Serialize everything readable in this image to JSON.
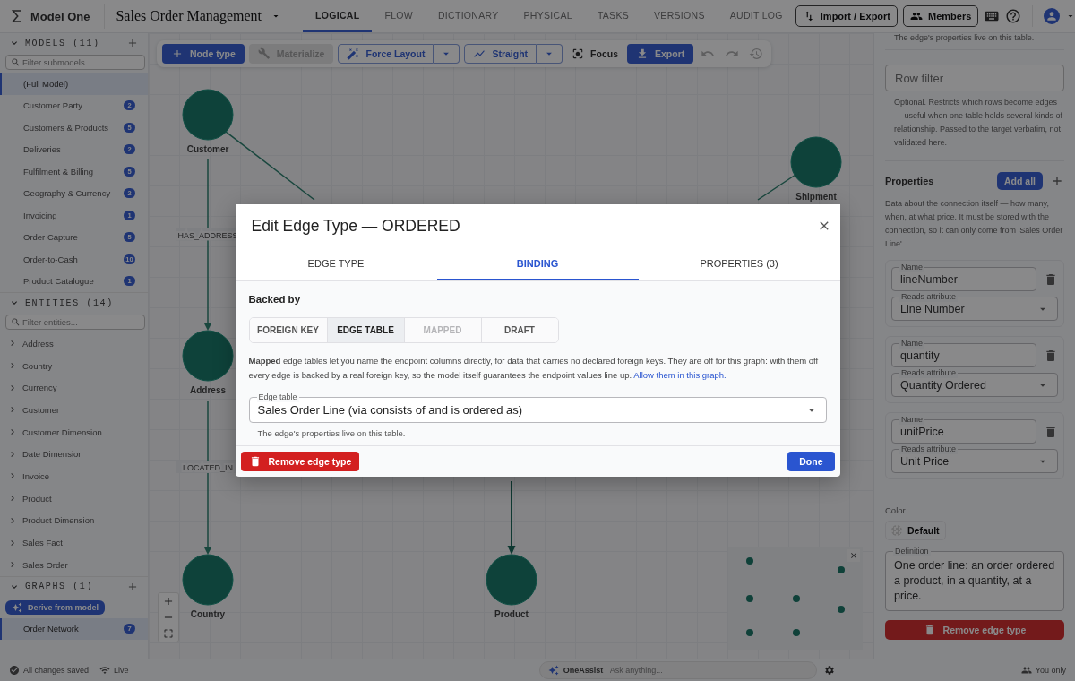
{
  "app": {
    "name": "Model One",
    "project": "Sales Order Management"
  },
  "nav_tabs": [
    {
      "label": "LOGICAL",
      "selected": true
    },
    {
      "label": "FLOW",
      "selected": false
    },
    {
      "label": "DICTIONARY",
      "selected": false
    },
    {
      "label": "PHYSICAL",
      "selected": false
    },
    {
      "label": "TASKS",
      "selected": false
    },
    {
      "label": "VERSIONS",
      "selected": false
    },
    {
      "label": "AUDIT LOG",
      "selected": false
    }
  ],
  "header_buttons": [
    "Import / Export",
    "Members"
  ],
  "sidebar": {
    "models": {
      "title": "MODELS (11)",
      "placeholder": "Filter submodels...",
      "items": [
        {
          "name": "(Full Model)",
          "selected": true
        },
        {
          "name": "Customer Party",
          "count": "2",
          "selected": false
        },
        {
          "name": "Customers & Products",
          "count": "5",
          "selected": false
        },
        {
          "name": "Deliveries",
          "count": "2",
          "selected": false
        },
        {
          "name": "Fulfilment & Billing",
          "count": "5",
          "selected": false
        },
        {
          "name": "Geography & Currency",
          "count": "2",
          "selected": false
        },
        {
          "name": "Invoicing",
          "count": "1",
          "selected": false
        },
        {
          "name": "Order Capture",
          "count": "5",
          "selected": false
        },
        {
          "name": "Order-to-Cash",
          "count": "10",
          "selected": false
        },
        {
          "name": "Product Catalogue",
          "count": "1",
          "selected": false
        }
      ]
    },
    "entities": {
      "title": "ENTITIES (14)",
      "placeholder": "Filter entities...",
      "items": [
        {
          "name": "Address",
          "expanded": false
        },
        {
          "name": "Country",
          "expanded": false
        },
        {
          "name": "Currency",
          "expanded": false
        },
        {
          "name": "Customer",
          "expanded": false
        },
        {
          "name": "Customer Dimension",
          "expanded": false
        },
        {
          "name": "Date Dimension",
          "expanded": false
        },
        {
          "name": "Invoice",
          "expanded": false
        },
        {
          "name": "Product",
          "expanded": false
        },
        {
          "name": "Product Dimension",
          "expanded": false
        },
        {
          "name": "Sales Fact",
          "expanded": false
        },
        {
          "name": "Sales Order",
          "expanded": false
        }
      ]
    },
    "graphs": {
      "title": "GRAPHS (1)",
      "derive_button": "Derive from model",
      "items": [
        {
          "name": "Order Network",
          "count": "7",
          "selected": true
        }
      ]
    }
  },
  "toolbar": [
    {
      "label": "Node type",
      "kind": "primary"
    },
    {
      "label": "Materialize",
      "kind": "disabled"
    },
    {
      "label": "Force Layout",
      "kind": "split"
    },
    {
      "label": "Straight",
      "kind": "split"
    },
    {
      "label": "Focus",
      "kind": "plain"
    },
    {
      "label": "Export",
      "kind": "primary"
    }
  ],
  "graph": {
    "nodes": [
      {
        "label": "Customer"
      },
      {
        "label": "Address"
      },
      {
        "label": "Country"
      },
      {
        "label": "Product"
      },
      {
        "label": "Shipment"
      }
    ],
    "edges": [
      {
        "label": "HAS_ADDRESS"
      },
      {
        "label": "LOCATED_IN"
      }
    ]
  },
  "modal": {
    "title": "Edit Edge Type — ORDERED",
    "tabs": [
      {
        "label": "EDGE TYPE",
        "selected": false
      },
      {
        "label": "BINDING",
        "selected": true
      },
      {
        "label": "PROPERTIES (3)",
        "selected": false
      }
    ],
    "section_label": "Backed by",
    "backing_options": [
      {
        "label": "FOREIGN KEY",
        "selected": false,
        "disabled": false
      },
      {
        "label": "EDGE TABLE",
        "selected": true,
        "disabled": false
      },
      {
        "label": "MAPPED",
        "selected": false,
        "disabled": true
      },
      {
        "label": "DRAFT",
        "selected": false,
        "disabled": false
      }
    ],
    "note": "**Mapped** edge tables let you name the endpoint columns directly, for data that carries no declared foreign keys. They are off for this graph: with them off every edge is backed by a real foreign key, so the model itself guarantees the endpoint values line up.",
    "note_link": "Allow them in this graph.",
    "edge_table": {
      "label": "Edge table",
      "value": "Sales Order Line (via consists of and is ordered as)",
      "helper": "The edge's properties live on this table."
    },
    "remove_button": "Remove edge type",
    "done_button": "Done"
  },
  "right_panel": {
    "top_note": "The edge's properties live on this table.",
    "row_filter": {
      "placeholder": "Row filter",
      "helper": "Optional. Restricts which rows become edges — useful when one table holds several kinds of relationship. Passed to the target verbatim, not validated here."
    },
    "properties": {
      "title": "Properties",
      "add_all": "Add all",
      "description": "Data about the connection itself — how many, when, at what price. It must be stored with the connection, so it can only come from 'Sales Order Line'.",
      "items": [
        {
          "name_label": "Name",
          "name": "lineNumber",
          "attr_label": "Reads attribute",
          "attribute": "Line Number"
        },
        {
          "name_label": "Name",
          "name": "quantity",
          "attr_label": "Reads attribute",
          "attribute": "Quantity Ordered"
        },
        {
          "name_label": "Name",
          "name": "unitPrice",
          "attr_label": "Reads attribute",
          "attribute": "Unit Price"
        }
      ]
    },
    "color": {
      "label": "Color",
      "value": "Default"
    },
    "definition": {
      "label": "Definition",
      "value": "One order line: an order ordered a product, in a quantity, at a price."
    },
    "remove_button": "Remove edge type"
  },
  "status_bar": {
    "saved": "All changes saved",
    "connection": "Live",
    "assistant": {
      "name": "OneAssist",
      "placeholder": "Ask anything..."
    },
    "presence": "You only"
  }
}
